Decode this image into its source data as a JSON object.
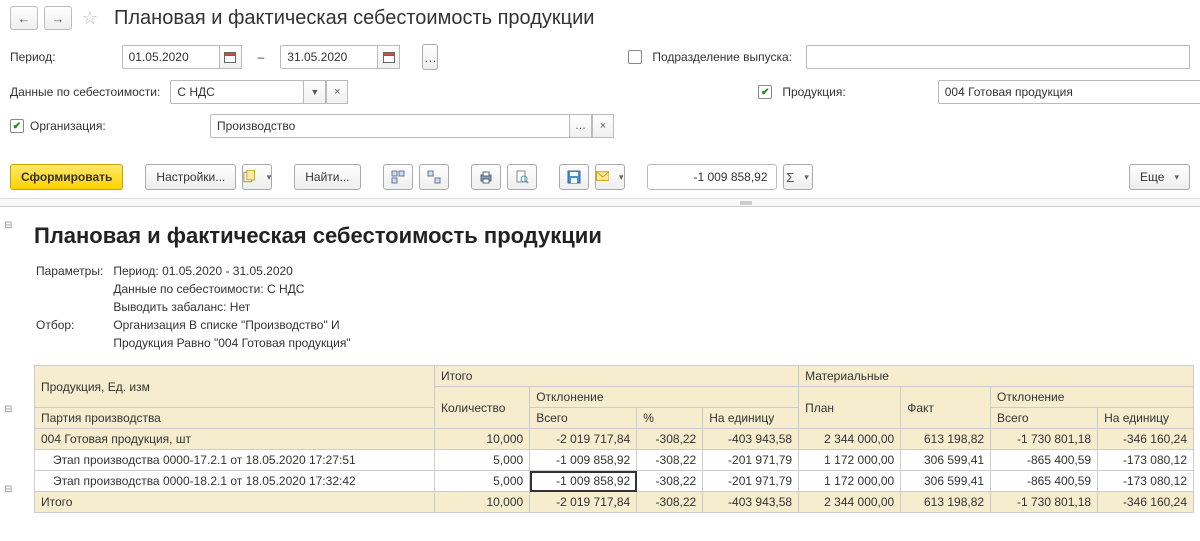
{
  "title": "Плановая и фактическая себестоимость продукции",
  "filters": {
    "period_label": "Период:",
    "date_from": "01.05.2020",
    "date_to": "31.05.2020",
    "dash": "–",
    "cost_label": "Данные по себестоимости:",
    "cost_value": "С НДС",
    "org_label": "Организация:",
    "org_checked": true,
    "org_value": "Производство",
    "unit_label": "Подразделение выпуска:",
    "unit_checked": false,
    "unit_value": "",
    "prod_label": "Продукция:",
    "prod_checked": true,
    "prod_value": "004 Готовая продукция"
  },
  "toolbar": {
    "run": "Сформировать",
    "settings": "Настройки...",
    "find": "Найти...",
    "value_readout": "-1 009 858,92",
    "sigma": "Σ",
    "more": "Еще"
  },
  "report": {
    "title": "Плановая и фактическая себестоимость продукции",
    "params_label": "Параметры:",
    "filter_label": "Отбор:",
    "params_lines": [
      "Период: 01.05.2020 - 31.05.2020",
      "Данные по себестоимости: С НДС",
      "Выводить забаланс: Нет"
    ],
    "filter_lines": [
      "Организация В списке \"Производство\" И",
      "Продукция Равно \"004 Готовая продукция\""
    ],
    "headers": {
      "prod": "Продукция, Ед. изм",
      "batch": "Партия производства",
      "itogo": "Итого",
      "qty": "Количество",
      "dev": "Отклонение",
      "vsego": "Всего",
      "pct": "%",
      "perunit": "На единицу",
      "material": "Материальные",
      "plan": "План",
      "fact": "Факт"
    },
    "rows": [
      {
        "kind": "group",
        "label": "004 Готовая продукция, шт",
        "qty": "10,000",
        "dev_total": "-2 019 717,84",
        "dev_pct": "-308,22",
        "dev_unit": "-403 943,58",
        "plan": "2 344 000,00",
        "fact": "613 198,82",
        "mdev_total": "-1 730 801,18",
        "mdev_unit": "-346 160,24"
      },
      {
        "kind": "detail",
        "label": "Этап производства 0000-17.2.1 от 18.05.2020 17:27:51",
        "qty": "5,000",
        "dev_total": "-1 009 858,92",
        "dev_pct": "-308,22",
        "dev_unit": "-201 971,79",
        "plan": "1 172 000,00",
        "fact": "306 599,41",
        "mdev_total": "-865 400,59",
        "mdev_unit": "-173 080,12"
      },
      {
        "kind": "detail",
        "label": "Этап производства 0000-18.2.1 от 18.05.2020 17:32:42",
        "qty": "5,000",
        "dev_total": "-1 009 858,92",
        "dev_pct": "-308,22",
        "dev_unit": "-201 971,79",
        "plan": "1 172 000,00",
        "fact": "306 599,41",
        "mdev_total": "-865 400,59",
        "mdev_unit": "-173 080,12",
        "selected": true
      },
      {
        "kind": "total",
        "label": "Итого",
        "qty": "10,000",
        "dev_total": "-2 019 717,84",
        "dev_pct": "-308,22",
        "dev_unit": "-403 943,58",
        "plan": "2 344 000,00",
        "fact": "613 198,82",
        "mdev_total": "-1 730 801,18",
        "mdev_unit": "-346 160,24"
      }
    ]
  }
}
